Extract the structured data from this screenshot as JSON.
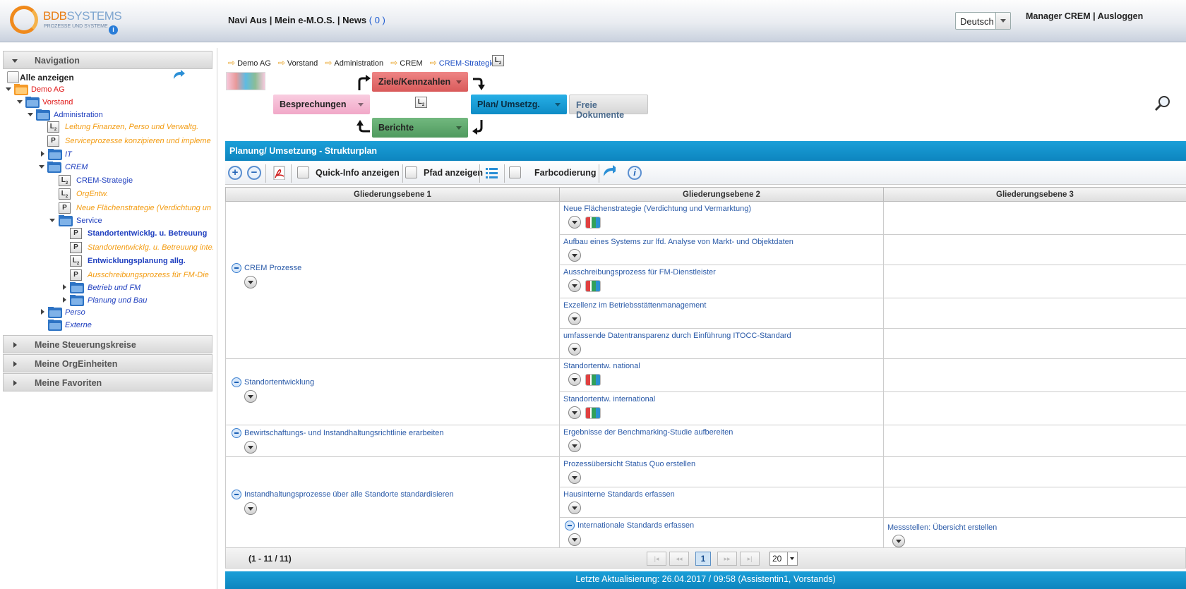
{
  "header": {
    "logo_name_a": "BDB",
    "logo_name_b": "SYSTEMS",
    "logo_tagline": "PROZESSE UND SYSTEME",
    "navi_aus": "Navi Aus",
    "mein_emos": "Mein e-M.O.S.",
    "news": "News",
    "news_count": "( 0 )",
    "separator": "|",
    "language": "Deutsch",
    "user": "Manager CREM",
    "logout": "Ausloggen"
  },
  "sidebar": {
    "navigation": "Navigation",
    "show_all": "Alle anzeigen",
    "tree": {
      "demo_ag": "Demo AG",
      "vorstand": "Vorstand",
      "administration": "Administration",
      "leitung": "Leitung Finanzen, Perso und Verwaltg.",
      "serviceprozesse": "Serviceprozesse konzipieren und impleme",
      "it": "IT",
      "crem": "CREM",
      "crem_strategie": "CREM-Strategie",
      "orgentw": "OrgEntw.",
      "neue_flaechen": "Neue Flächenstrategie (Verdichtung un",
      "service": "Service",
      "standort_bold": "Standortentwicklg. u. Betreuung",
      "standort_inte": "Standortentwicklg. u. Betreuung inte.",
      "entwicklungsplanung": "Entwicklungsplanung allg.",
      "ausschreibung": "Ausschreibungsprozess für FM-Die",
      "betrieb": "Betrieb und FM",
      "planung": "Planung und Bau",
      "perso": "Perso",
      "externe": "Externe"
    },
    "steuerungskreise": "Meine Steuerungskreise",
    "orgeinheiten": "Meine OrgEinheiten",
    "favoriten": "Meine Favoriten"
  },
  "breadcrumb": [
    "Demo AG",
    "Vorstand",
    "Administration",
    "CREM",
    "CREM-Strategie"
  ],
  "process": {
    "ziele": "Ziele/Kennzahlen",
    "besprechungen": "Besprechungen",
    "plan": "Plan/ Umsetzg.",
    "berichte": "Berichte",
    "freie": "Freie Dokumente"
  },
  "panel_title": "Planung/ Umsetzung - Strukturplan",
  "toolbar": {
    "quick_info": "Quick-Info anzeigen",
    "pfad": "Pfad anzeigen",
    "farb": "Farbcodierung"
  },
  "grid": {
    "headers": [
      "Gliederungsebene 1",
      "Gliederungsebene 2",
      "Gliederungsebene 3"
    ],
    "level1": [
      "CREM Prozesse",
      "Standortentwicklung",
      "Bewirtschaftungs- und Instandhaltungsrichtlinie erarbeiten",
      "Instandhaltungsprozesse über alle Standorte standardisieren"
    ],
    "level2": [
      "Neue Flächenstrategie (Verdichtung und Vermarktung)",
      "Aufbau eines Systems zur lfd. Analyse von Markt- und Objektdaten",
      "Ausschreibungsprozess für FM-Dienstleister",
      "Exzellenz im Betriebsstättenmanagement",
      "umfassende Datentransparenz durch Einführung ITOCC-Standard",
      "Standortentw. national",
      "Standortentw. international",
      "Ergebnisse der Benchmarking-Studie aufbereiten",
      "Prozessübersicht Status Quo erstellen",
      "Hausinterne Standards erfassen",
      "Internationale Standards erfassen"
    ],
    "level3": [
      "Messstellen: Übersicht erstellen"
    ]
  },
  "pager": {
    "count": "(1 - 11 / 11)",
    "page": "1",
    "page_size": "20"
  },
  "footer": "Letzte Aktualisierung: 26.04.2017 / 09:58 (Assistentin1, Vorstands)",
  "colors": {
    "accent": "#1a9fd8",
    "ziele": "#e06e6e",
    "besprechungen": "#f3b3cf",
    "plan": "#1a9fd8",
    "berichte": "#5aa26a"
  }
}
